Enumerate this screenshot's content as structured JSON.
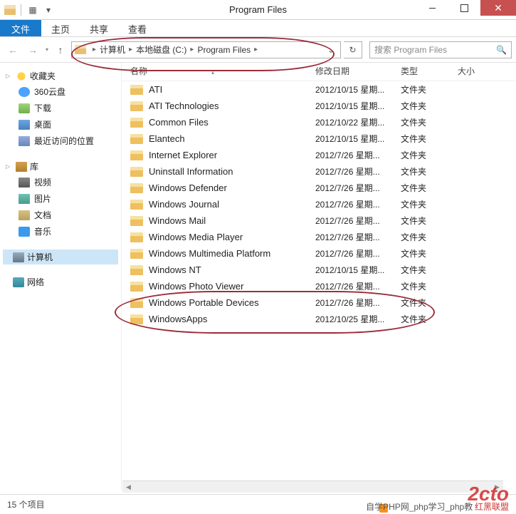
{
  "window": {
    "title": "Program Files"
  },
  "ribbon": {
    "file": "文件",
    "tabs": [
      "主页",
      "共享",
      "查看"
    ]
  },
  "breadcrumb": {
    "items": [
      "计算机",
      "本地磁盘 (C:)",
      "Program Files"
    ]
  },
  "search": {
    "placeholder": "搜索 Program Files"
  },
  "columns": {
    "name": "名称",
    "date": "修改日期",
    "type": "类型",
    "size": "大小"
  },
  "sidebar": {
    "favorites": {
      "label": "收藏夹",
      "items": [
        {
          "label": "360云盘"
        },
        {
          "label": "下载"
        },
        {
          "label": "桌面"
        },
        {
          "label": "最近访问的位置"
        }
      ]
    },
    "libraries": {
      "label": "库",
      "items": [
        {
          "label": "视频"
        },
        {
          "label": "图片"
        },
        {
          "label": "文档"
        },
        {
          "label": "音乐"
        }
      ]
    },
    "computer": {
      "label": "计算机"
    },
    "network": {
      "label": "网络"
    }
  },
  "files": [
    {
      "name": "ATI",
      "date": "2012/10/15 星期...",
      "type": "文件夹"
    },
    {
      "name": "ATI Technologies",
      "date": "2012/10/15 星期...",
      "type": "文件夹"
    },
    {
      "name": "Common Files",
      "date": "2012/10/22 星期...",
      "type": "文件夹"
    },
    {
      "name": "Elantech",
      "date": "2012/10/15 星期...",
      "type": "文件夹"
    },
    {
      "name": "Internet Explorer",
      "date": "2012/7/26 星期...",
      "type": "文件夹"
    },
    {
      "name": "Uninstall Information",
      "date": "2012/7/26 星期...",
      "type": "文件夹"
    },
    {
      "name": "Windows Defender",
      "date": "2012/7/26 星期...",
      "type": "文件夹"
    },
    {
      "name": "Windows Journal",
      "date": "2012/7/26 星期...",
      "type": "文件夹"
    },
    {
      "name": "Windows Mail",
      "date": "2012/7/26 星期...",
      "type": "文件夹"
    },
    {
      "name": "Windows Media Player",
      "date": "2012/7/26 星期...",
      "type": "文件夹"
    },
    {
      "name": "Windows Multimedia Platform",
      "date": "2012/7/26 星期...",
      "type": "文件夹"
    },
    {
      "name": "Windows NT",
      "date": "2012/10/15 星期...",
      "type": "文件夹"
    },
    {
      "name": "Windows Photo Viewer",
      "date": "2012/7/26 星期...",
      "type": "文件夹"
    },
    {
      "name": "Windows Portable Devices",
      "date": "2012/7/26 星期...",
      "type": "文件夹"
    },
    {
      "name": "WindowsApps",
      "date": "2012/10/25 星期...",
      "type": "文件夹"
    }
  ],
  "status": {
    "count": "15 个项目"
  },
  "watermark": {
    "logo": "2cto",
    "text": "自学PHP网_php学习_php教",
    "sub": "红黑联盟"
  }
}
